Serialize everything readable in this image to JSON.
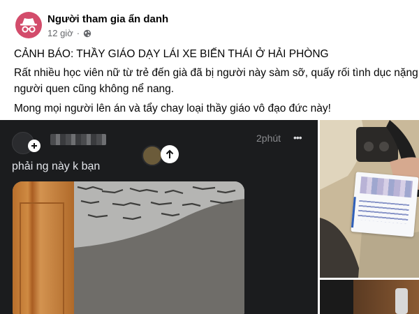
{
  "post": {
    "author": "Người tham gia ẩn danh",
    "time": "12 giờ",
    "title_line": "CẢNH BÁO: THẦY GIÁO DẠY LÁI XE BIẾN THÁI Ở HẢI PHÒNG",
    "body_line1": "Rất nhiều học viên nữ từ trẻ đến già đã bị người này sàm sỡ, quấy rối tình dục nặng nề.",
    "body_line2": "người quen cũng không nể nang.",
    "body_line3": "Mong mọi người lên án và tẩy chay loại thầy giáo vô đạo đức này!"
  },
  "screenshot": {
    "time_label": "2phút",
    "more_label": "•••",
    "caption": "phải ng này k bạn"
  },
  "colors": {
    "avatar_bg": "#d34c6b",
    "meta_gray": "#65676b",
    "dark_media_bg": "#1b1c1e"
  },
  "icons": {
    "avatar": "incognito-icon",
    "privacy": "globe-icon",
    "upload": "arrow-up-icon",
    "add": "plus-icon"
  }
}
